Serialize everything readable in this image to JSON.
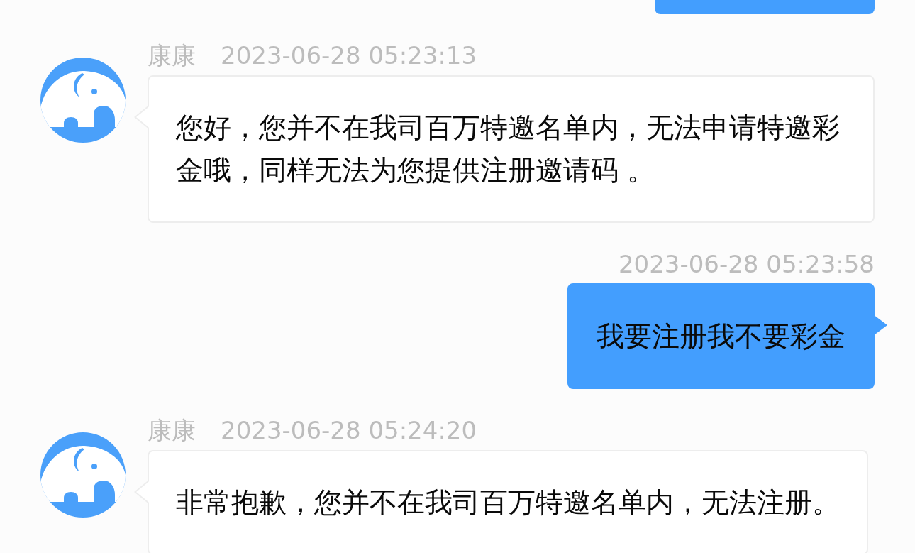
{
  "messages": [
    {
      "kind": "outgoing",
      "clipped": true
    },
    {
      "kind": "incoming",
      "clipped": false,
      "sender": "康康",
      "time": "2023-06-28 05:23:13",
      "text": "您好，您并不在我司百万特邀名单内，无法申请特邀彩金哦，同样无法为您提供注册邀请码 。"
    },
    {
      "kind": "outgoing",
      "clipped": false,
      "time": "2023-06-28 05:23:58",
      "text": "我要注册我不要彩金"
    },
    {
      "kind": "incoming",
      "clipped": false,
      "sender": "康康",
      "time": "2023-06-28 05:24:20",
      "text": "非常抱歉，您并不在我司百万特邀名单内，无法注册。"
    }
  ]
}
